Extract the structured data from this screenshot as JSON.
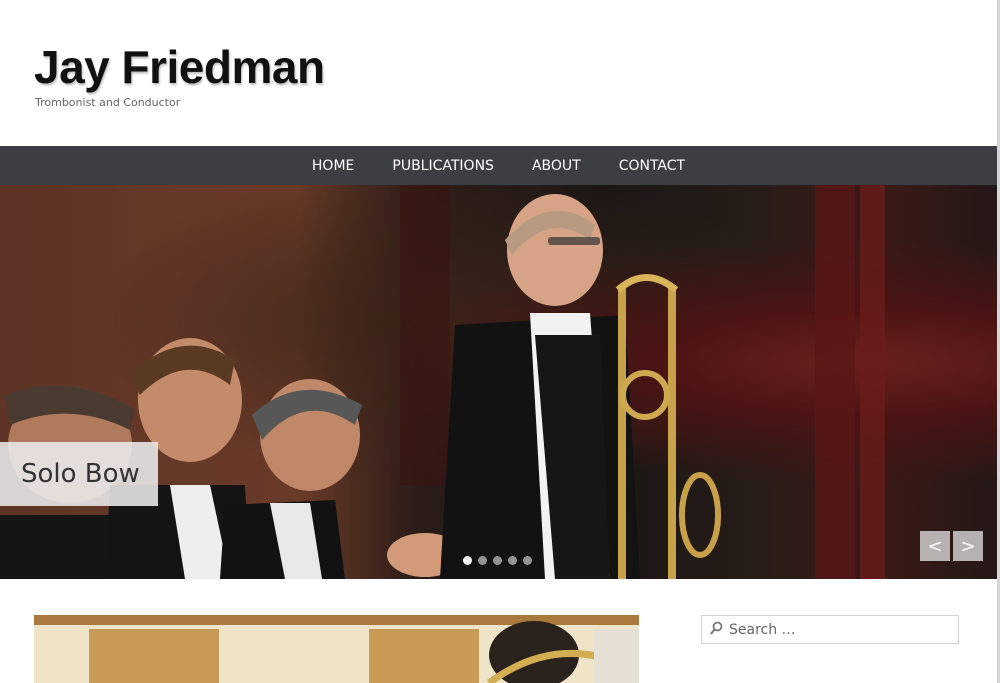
{
  "header": {
    "title": "Jay Friedman",
    "tagline": "Trombonist and Conductor"
  },
  "nav": {
    "items": [
      {
        "label": "HOME"
      },
      {
        "label": "PUBLICATIONS"
      },
      {
        "label": "ABOUT"
      },
      {
        "label": "CONTACT"
      }
    ]
  },
  "slider": {
    "caption": "Solo Bow",
    "slide_count": 5,
    "active_slide": 1,
    "prev_label": "<",
    "next_label": ">",
    "image_description_icon": "orchestra-photo"
  },
  "sidebar": {
    "search_placeholder": "Search …",
    "search_icon": "search-icon"
  },
  "colors": {
    "nav_background": "#3b3e42",
    "nav_text": "#ffffff",
    "title_text": "#111111",
    "tagline_text": "#666666"
  }
}
